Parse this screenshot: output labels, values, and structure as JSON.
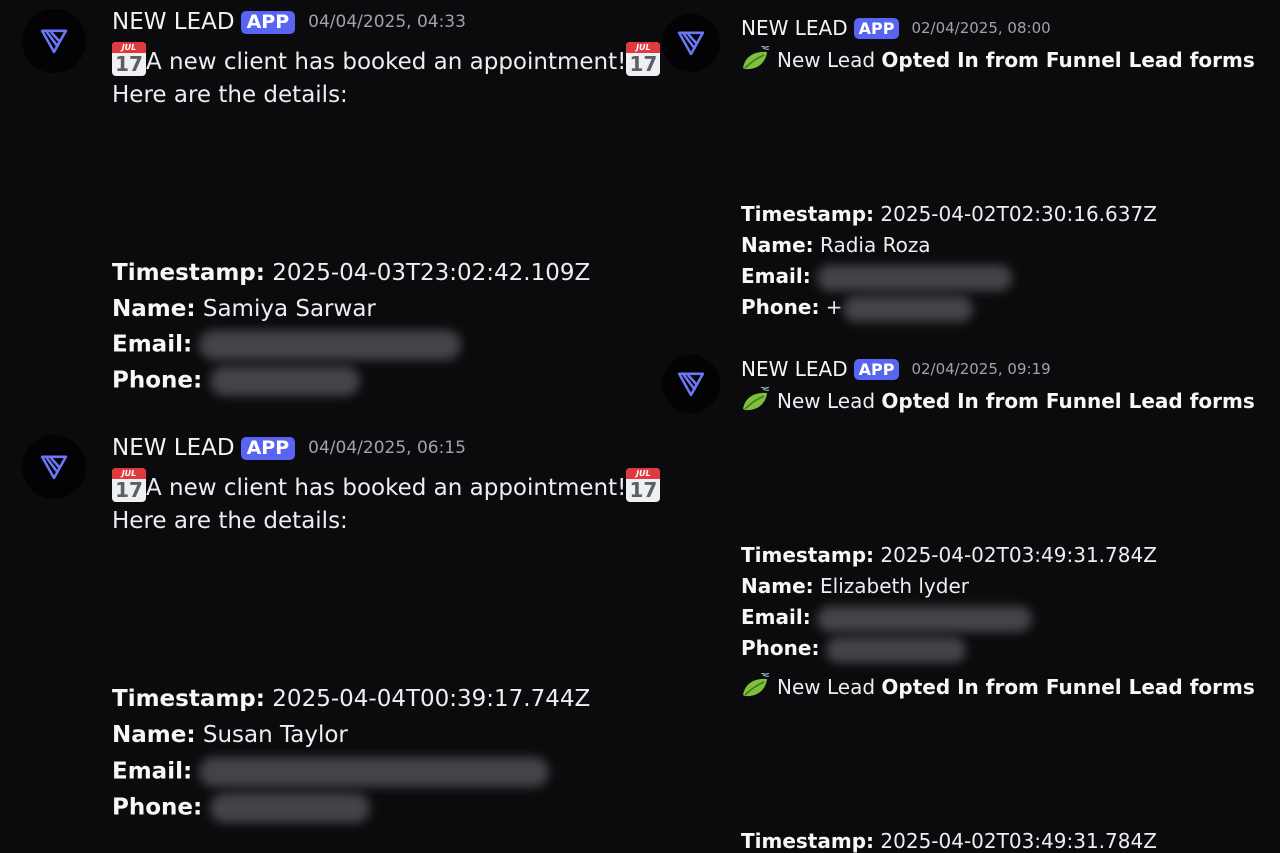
{
  "messages_left": [
    {
      "author": "NEW LEAD",
      "badge": "APP",
      "time": "04/04/2025, 04:33",
      "intro": "A new client has booked an appointment!",
      "details_label": "Here are the details:",
      "timestamp_label": "Timestamp:",
      "timestamp_value": "2025-04-03T23:02:42.109Z",
      "name_label": "Name:",
      "name_value": "Samiya Sarwar",
      "email_label": "Email:",
      "phone_label": "Phone:"
    },
    {
      "author": "NEW LEAD",
      "badge": "APP",
      "time": "04/04/2025, 06:15",
      "intro": "A new client has booked an appointment!",
      "details_label": "Here are the details:",
      "timestamp_label": "Timestamp:",
      "timestamp_value": "2025-04-04T00:39:17.744Z",
      "name_label": "Name:",
      "name_value": "Susan Taylor",
      "email_label": "Email:",
      "phone_label": "Phone:"
    }
  ],
  "messages_right": [
    {
      "author": "NEW LEAD",
      "badge": "APP",
      "time": "02/04/2025, 08:00",
      "intro_plain": "New Lead ",
      "intro_bold": "Opted In from Funnel Lead forms",
      "timestamp_label": "Timestamp:",
      "timestamp_value": "2025-04-02T02:30:16.637Z",
      "name_label": "Name:",
      "name_value": "Radia Roza",
      "email_label": "Email:",
      "phone_label": "Phone:",
      "phone_prefix": "+"
    },
    {
      "author": "NEW LEAD",
      "badge": "APP",
      "time": "02/04/2025, 09:19",
      "intro_plain": "New Lead ",
      "intro_bold": "Opted In from Funnel Lead forms",
      "timestamp_label": "Timestamp:",
      "timestamp_value": "2025-04-02T03:49:31.784Z",
      "name_label": "Name:",
      "name_value": "Elizabeth lyder",
      "email_label": "Email:",
      "phone_label": "Phone:",
      "followup_plain": "New Lead ",
      "followup_bold": "Opted In from Funnel Lead forms",
      "followup_timestamp_label": "Timestamp:",
      "followup_timestamp_value": "2025-04-02T03:49:31.784Z"
    }
  ],
  "calendar_icon": {
    "month": "JUL",
    "day": "17"
  },
  "icons": {
    "avatar": "bot-logo-icon",
    "calendar": "calendar-icon",
    "leaf": "leaf-wind-icon"
  },
  "colors": {
    "badge": "#5865f2",
    "background": "#0b0b0d",
    "timestamp": "#9fa3aa"
  }
}
